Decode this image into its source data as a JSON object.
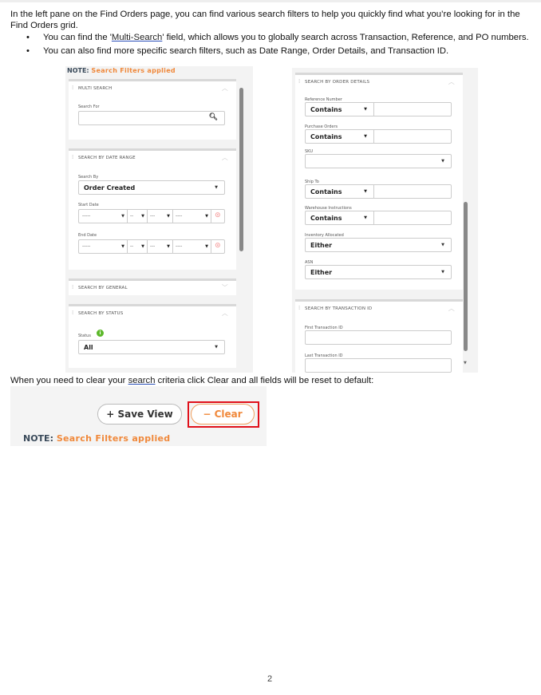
{
  "intro": "In the left pane on the Find Orders page, you can find various search filters to help you quickly find what you’re looking for in the Find Orders grid.",
  "bullets": [
    {
      "pre": "You can find the '",
      "link": "Multi-Search",
      "post": "' field, which allows you to globally search across Transaction, Reference, and PO numbers."
    },
    {
      "pre": "You can also find more specific search filters, such as Date Range, Order Details, and Transaction ID.",
      "link": "",
      "post": ""
    }
  ],
  "note": {
    "label": "NOTE:",
    "text": "Search Filters applied"
  },
  "left_panel": {
    "multi_search": {
      "title": "MULTI SEARCH",
      "search_for_label": "Search For",
      "search_value": ""
    },
    "date_range": {
      "title": "SEARCH BY DATE RANGE",
      "search_by_label": "Search By",
      "search_by_value": "Order Created",
      "start_label": "Start Date",
      "end_label": "End Date",
      "placeholders": [
        "-----",
        "--",
        "---",
        "----"
      ]
    },
    "general": {
      "title": "SEARCH BY GENERAL"
    },
    "status": {
      "title": "SEARCH BY STATUS",
      "label": "Status",
      "info": "i",
      "value": "All"
    }
  },
  "right_panel": {
    "order_details": {
      "title": "SEARCH BY ORDER DETAILS",
      "fields": [
        {
          "label": "Reference Number",
          "op": "Contains",
          "type": "split"
        },
        {
          "label": "Purchase Orders",
          "op": "Contains",
          "type": "split"
        },
        {
          "label": "SKU",
          "op": "",
          "type": "select"
        },
        {
          "label": "Ship To",
          "op": "Contains",
          "type": "split"
        },
        {
          "label": "Warehouse Instructions",
          "op": "Contains",
          "type": "split"
        },
        {
          "label": "Inventory Allocated",
          "op": "Either",
          "type": "select"
        },
        {
          "label": "ASN",
          "op": "Either",
          "type": "select"
        }
      ]
    },
    "transaction": {
      "title": "SEARCH BY TRANSACTION ID",
      "first_label": "First Transaction ID",
      "last_label": "Last Transaction ID"
    }
  },
  "clear_text": {
    "pre": "When you need to clear your ",
    "link": "search",
    "post": " criteria click Clear and all fields will be reset to default:"
  },
  "buttons": {
    "save_view": "+ Save View",
    "clear": "− Clear"
  },
  "colors": {
    "accent": "#f0883a",
    "highlight": "#e0101a",
    "status_info": "#5cb82a"
  },
  "page_number": "2"
}
